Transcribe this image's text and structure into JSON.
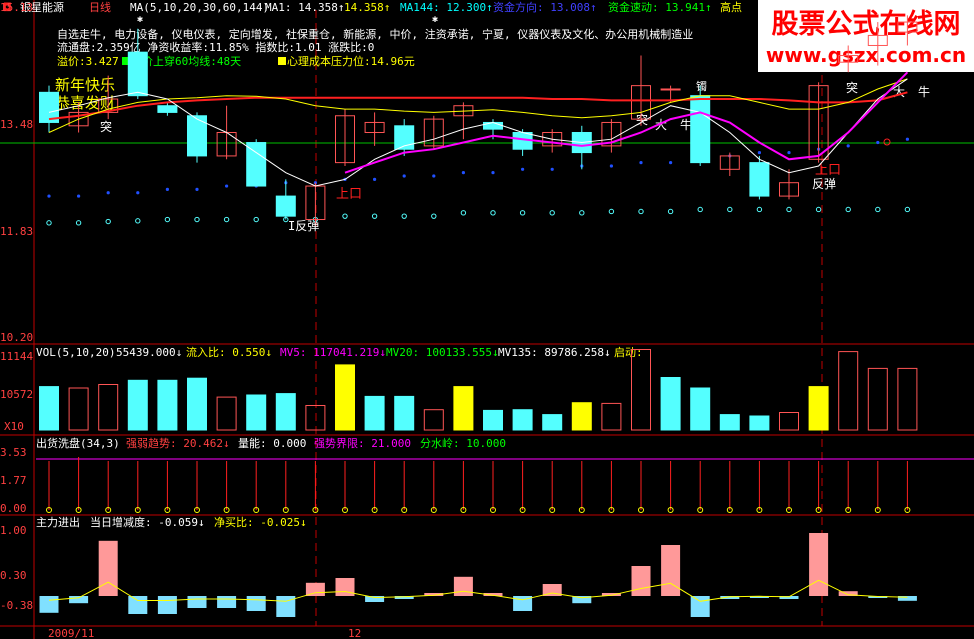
{
  "header": {
    "stock_name": "银星能源",
    "period": "日线",
    "ma_label": "MA(5,10,20,30,60,144)",
    "ma1": "MA1: 14.358↑",
    "ma_val2": "14.358↑",
    "ma144": "MA144: 12.300↑",
    "fund_direction": "资金方向: 13.008↑",
    "fund_speed": "资金速动: 13.941↑",
    "high_point": "高点"
  },
  "info": {
    "line1": "自选走牛, 电力设备, 仪电仪表, 定向增发, 社保重仓, 新能源, 中价, 注资承诺, 宁夏, 仪器仪表及文化、办公用机械制造业",
    "line2": "流通盘:2.359亿        净资收益率:11.85%        指数比:1.01            涨跌比:0",
    "line3a": "溢价:3.427",
    "line3b": "股价上穿60均线:48天",
    "line3c": "心理成本压力位:14.96元",
    "greet1": "新年快乐",
    "greet2": "恭喜发财"
  },
  "annotations": {
    "tu": "突",
    "shangkou": "上口",
    "fantan1": "I反弹",
    "fantan2": "反弹",
    "da": "大",
    "niu": "牛",
    "zhuo": "镯"
  },
  "axis": {
    "price_ticks": [
      "15.13",
      "13.48",
      "11.83",
      "10.20"
    ],
    "vol_ticks": [
      "11144",
      "10572"
    ],
    "vol_unit": "X10",
    "wash_ticks": [
      "3.53",
      "1.77",
      "0.00"
    ],
    "main_ticks": [
      "1.00",
      "0.30",
      "-0.38"
    ],
    "dates": [
      "2009/11",
      "12"
    ]
  },
  "vol_panel": {
    "title": "VOL(5,10,20)",
    "v": "55439.000↓",
    "inflow": "流入比: 0.550↓",
    "mv5": "MV5: 117041.219↓",
    "mv20": "MV20: 100133.555↓",
    "mv135": "MV135: 89786.258↓",
    "start": "启动:"
  },
  "wash_panel": {
    "title": "出货洗盘(34,3)",
    "strength": "强弱趋势: 20.462↓",
    "energy": "量能: 0.000",
    "boundary": "强势界限: 21.000",
    "watershed": "分水岭: 10.000"
  },
  "main_panel": {
    "title": "主力进出",
    "daily": "当日增减度: -0.059↓",
    "netbuy": "净买比: -0.025↓"
  },
  "watermark": {
    "title": "股票公式在线网",
    "url": "www.gszx.com.cn"
  },
  "colors": {
    "up": "#ff5555",
    "down": "#54ffff",
    "ma_white": "#ffffff",
    "ma_yellow": "#ffff00",
    "ma_magenta": "#ff00ff",
    "ma_red": "#ff2020",
    "panel_border": "#c00000"
  },
  "chart_data": {
    "type": "candlestick",
    "price_range": [
      10.2,
      15.13
    ],
    "candles": [
      {
        "o": 13.9,
        "c": 13.45,
        "h": 14.0,
        "l": 13.3
      },
      {
        "o": 13.4,
        "c": 13.6,
        "h": 13.75,
        "l": 13.3
      },
      {
        "o": 13.6,
        "c": 13.8,
        "h": 14.15,
        "l": 13.5
      },
      {
        "o": 14.5,
        "c": 13.85,
        "h": 14.85,
        "l": 13.8
      },
      {
        "o": 13.7,
        "c": 13.6,
        "h": 13.75,
        "l": 13.55
      },
      {
        "o": 13.55,
        "c": 12.95,
        "h": 13.6,
        "l": 12.85
      },
      {
        "o": 12.95,
        "c": 13.3,
        "h": 13.7,
        "l": 12.9
      },
      {
        "o": 13.15,
        "c": 12.5,
        "h": 13.2,
        "l": 12.5
      },
      {
        "o": 12.35,
        "c": 12.05,
        "h": 12.6,
        "l": 12.0
      },
      {
        "o": 12.0,
        "c": 12.5,
        "h": 12.55,
        "l": 11.95
      },
      {
        "o": 12.85,
        "c": 13.55,
        "h": 13.65,
        "l": 12.8
      },
      {
        "o": 13.3,
        "c": 13.45,
        "h": 13.6,
        "l": 13.1
      },
      {
        "o": 13.4,
        "c": 13.05,
        "h": 13.5,
        "l": 12.95
      },
      {
        "o": 13.1,
        "c": 13.5,
        "h": 13.55,
        "l": 13.05
      },
      {
        "o": 13.55,
        "c": 13.7,
        "h": 13.75,
        "l": 13.2
      },
      {
        "o": 13.45,
        "c": 13.35,
        "h": 13.5,
        "l": 13.2
      },
      {
        "o": 13.3,
        "c": 13.05,
        "h": 13.35,
        "l": 12.95
      },
      {
        "o": 13.1,
        "c": 13.3,
        "h": 13.35,
        "l": 13.0
      },
      {
        "o": 13.3,
        "c": 13.0,
        "h": 13.4,
        "l": 12.75
      },
      {
        "o": 13.1,
        "c": 13.45,
        "h": 13.5,
        "l": 13.0
      },
      {
        "o": 13.5,
        "c": 14.0,
        "h": 14.45,
        "l": 13.4
      },
      {
        "o": 13.95,
        "c": 13.95,
        "h": 14.0,
        "l": 13.75
      },
      {
        "o": 13.85,
        "c": 12.85,
        "h": 14.0,
        "l": 12.8
      },
      {
        "o": 12.75,
        "c": 12.95,
        "h": 13.0,
        "l": 12.65
      },
      {
        "o": 12.85,
        "c": 12.35,
        "h": 12.95,
        "l": 12.3
      },
      {
        "o": 12.35,
        "c": 12.55,
        "h": 12.75,
        "l": 12.3
      },
      {
        "o": 12.9,
        "c": 14.0,
        "h": 14.05,
        "l": 12.85
      },
      {
        "o": 14.35,
        "c": 14.45,
        "h": 14.6,
        "l": 14.2
      },
      {
        "o": 14.6,
        "c": 14.75,
        "h": 14.95,
        "l": 14.3
      },
      {
        "o": 14.8,
        "c": 14.95,
        "h": 15.05,
        "l": 14.6
      }
    ],
    "ma_white": [
      13.6,
      13.7,
      13.82,
      13.9,
      13.8,
      13.5,
      13.3,
      13.0,
      12.7,
      12.5,
      12.6,
      12.9,
      13.1,
      13.2,
      13.35,
      13.45,
      13.3,
      13.2,
      13.15,
      13.2,
      13.45,
      13.7,
      13.6,
      13.3,
      12.9,
      12.7,
      12.8,
      13.3,
      13.8,
      14.1
    ],
    "ma_yellow": [
      13.3,
      13.5,
      13.65,
      13.75,
      13.8,
      13.82,
      13.85,
      13.84,
      13.8,
      13.7,
      13.65,
      13.65,
      13.62,
      13.6,
      13.62,
      13.64,
      13.6,
      13.55,
      13.52,
      13.55,
      13.6,
      13.75,
      13.85,
      13.85,
      13.75,
      13.65,
      13.65,
      13.75,
      13.95,
      14.1
    ],
    "ma_red": [
      13.5,
      13.55,
      13.62,
      13.7,
      13.75,
      13.78,
      13.8,
      13.82,
      13.82,
      13.82,
      13.82,
      13.82,
      13.82,
      13.82,
      13.82,
      13.82,
      13.82,
      13.8,
      13.8,
      13.78,
      13.78,
      13.78,
      13.8,
      13.8,
      13.8,
      13.78,
      13.75,
      13.75,
      13.78,
      13.9
    ],
    "ma_magenta": [
      null,
      null,
      null,
      null,
      null,
      null,
      null,
      null,
      null,
      null,
      12.7,
      12.85,
      13.0,
      13.05,
      13.15,
      13.25,
      13.2,
      13.15,
      13.1,
      13.15,
      13.3,
      13.5,
      13.6,
      13.45,
      13.15,
      12.9,
      12.95,
      13.3,
      13.75,
      14.2
    ],
    "dots_blue": [
      12.35,
      12.35,
      12.4,
      12.4,
      12.45,
      12.45,
      12.5,
      12.5,
      12.55,
      12.55,
      12.6,
      12.6,
      12.65,
      12.65,
      12.7,
      12.7,
      12.75,
      12.75,
      12.8,
      12.8,
      12.85,
      12.85,
      12.9,
      12.95,
      13.0,
      13.0,
      13.05,
      13.1,
      13.15,
      13.2
    ],
    "dots_cyan": [
      11.95,
      11.95,
      11.97,
      11.98,
      12.0,
      12.0,
      12.0,
      12.0,
      12.0,
      12.0,
      12.05,
      12.05,
      12.05,
      12.05,
      12.1,
      12.1,
      12.1,
      12.1,
      12.1,
      12.12,
      12.12,
      12.12,
      12.15,
      12.15,
      12.15,
      12.15,
      12.15,
      12.15,
      12.15,
      12.15
    ],
    "volumes": [
      {
        "v": 0.62,
        "c": "down"
      },
      {
        "v": 0.6,
        "c": "up"
      },
      {
        "v": 0.65,
        "c": "up"
      },
      {
        "v": 0.71,
        "c": "down"
      },
      {
        "v": 0.71,
        "c": "down"
      },
      {
        "v": 0.74,
        "c": "down"
      },
      {
        "v": 0.47,
        "c": "up"
      },
      {
        "v": 0.5,
        "c": "down"
      },
      {
        "v": 0.52,
        "c": "down"
      },
      {
        "v": 0.35,
        "c": "up"
      },
      {
        "v": 0.93,
        "c": "yellow"
      },
      {
        "v": 0.48,
        "c": "down"
      },
      {
        "v": 0.48,
        "c": "down"
      },
      {
        "v": 0.29,
        "c": "up"
      },
      {
        "v": 0.62,
        "c": "yellow"
      },
      {
        "v": 0.28,
        "c": "down"
      },
      {
        "v": 0.29,
        "c": "down"
      },
      {
        "v": 0.22,
        "c": "down"
      },
      {
        "v": 0.39,
        "c": "yellow"
      },
      {
        "v": 0.38,
        "c": "up"
      },
      {
        "v": 1.15,
        "c": "up"
      },
      {
        "v": 0.75,
        "c": "down"
      },
      {
        "v": 0.6,
        "c": "down"
      },
      {
        "v": 0.22,
        "c": "down"
      },
      {
        "v": 0.2,
        "c": "down"
      },
      {
        "v": 0.25,
        "c": "up"
      },
      {
        "v": 0.62,
        "c": "yellow"
      },
      {
        "v": 1.12,
        "c": "up"
      },
      {
        "v": 0.88,
        "c": "up"
      },
      {
        "v": 0.88,
        "c": "up"
      }
    ],
    "wash_values": [
      0.35,
      3.6,
      0.3,
      0.3,
      0.3,
      0.3,
      0.3,
      0.3,
      0.3,
      0.3,
      0.3,
      0.3,
      0.3,
      0.3,
      0.3,
      0.3,
      0.3,
      0.3,
      0.3,
      0.3,
      0.3,
      0.3,
      0.3,
      0.3,
      0.3,
      0.3,
      0.3,
      0.3,
      0.3,
      0.3
    ],
    "main_values": [
      -0.28,
      -0.12,
      0.92,
      -0.3,
      -0.3,
      -0.2,
      -0.2,
      -0.25,
      -0.35,
      0.22,
      0.3,
      -0.1,
      -0.05,
      0.05,
      0.32,
      0.05,
      -0.25,
      0.2,
      -0.12,
      0.05,
      0.5,
      0.85,
      -0.35,
      -0.05,
      -0.02,
      -0.05,
      1.05,
      0.08,
      -0.03,
      -0.08
    ]
  }
}
